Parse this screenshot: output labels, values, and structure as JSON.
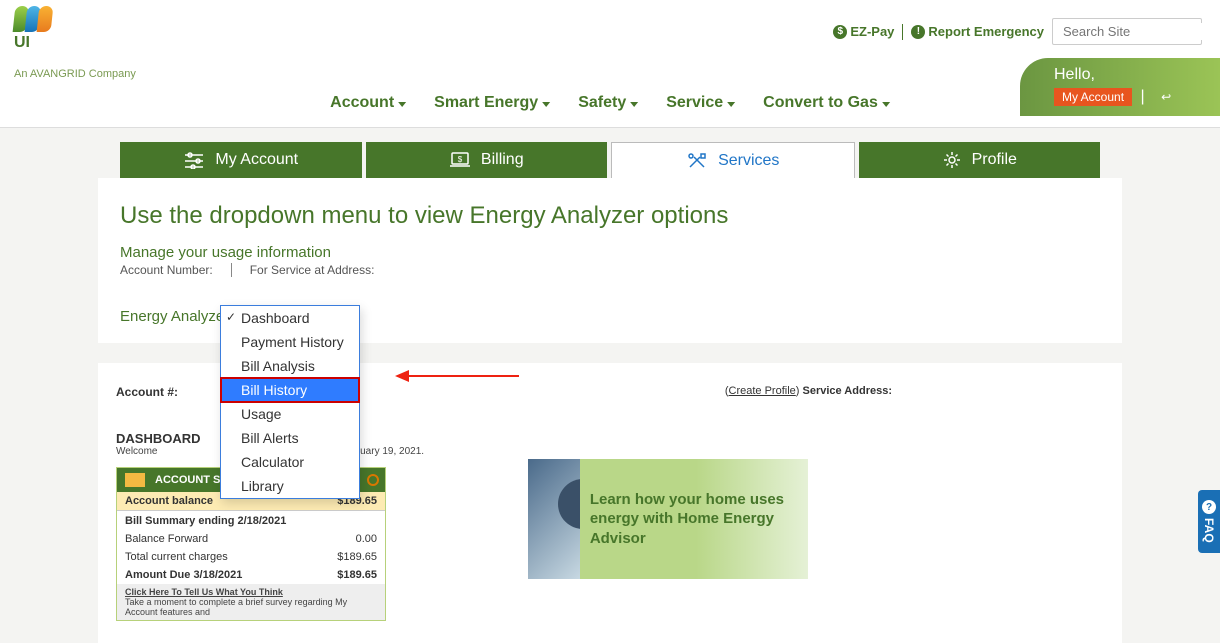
{
  "brand": {
    "code": "UI",
    "tagline": "An AVANGRID Company"
  },
  "util": {
    "ezpay": "EZ-Pay",
    "report": "Report Emergency",
    "search_placeholder": "Search Site"
  },
  "hello": {
    "greeting": "Hello,",
    "my_account": "My Account"
  },
  "nav": {
    "account": "Account",
    "smart_energy": "Smart Energy",
    "safety": "Safety",
    "service": "Service",
    "convert": "Convert to Gas"
  },
  "tabs": {
    "my_account": "My Account",
    "billing": "Billing",
    "services": "Services",
    "profile": "Profile"
  },
  "page": {
    "title": "Use the dropdown menu to view Energy Analyzer options",
    "subtitle": "Manage your usage information",
    "acct_label": "Account Number:",
    "svc_label": "For Service at Address:",
    "dd_label": "Energy Analyzer"
  },
  "dropdown": {
    "items": [
      "Dashboard",
      "Payment History",
      "Bill Analysis",
      "Bill History",
      "Usage",
      "Bill Alerts",
      "Calculator",
      "Library"
    ],
    "selected_index": 0,
    "hover_index": 3
  },
  "lower": {
    "acct_label": "Account #:",
    "create_profile": "Create Profile",
    "svc_addr_label": "Service Address:",
    "dash": "DASHBOARD",
    "welcome": "Welcome",
    "today": "Today is Friday, February 19, 2021."
  },
  "summary": {
    "head": "ACCOUNT SUMMARY",
    "rows": {
      "balance_label": "Account balance",
      "balance_val": "$189.65",
      "ending_label": "Bill Summary ending 2/18/2021",
      "fwd_label": "Balance Forward",
      "fwd_val": "0.00",
      "curr_label": "Total current charges",
      "curr_val": "$189.65",
      "due_label": "Amount Due 3/18/2021",
      "due_val": "$189.65"
    },
    "foot_line1": "Click Here To Tell Us What You Think",
    "foot_line2": "Take a moment to complete a brief survey regarding My Account features and"
  },
  "promo": {
    "text": "Learn how your home uses energy with Home Energy Advisor"
  },
  "faq": "FAQ"
}
